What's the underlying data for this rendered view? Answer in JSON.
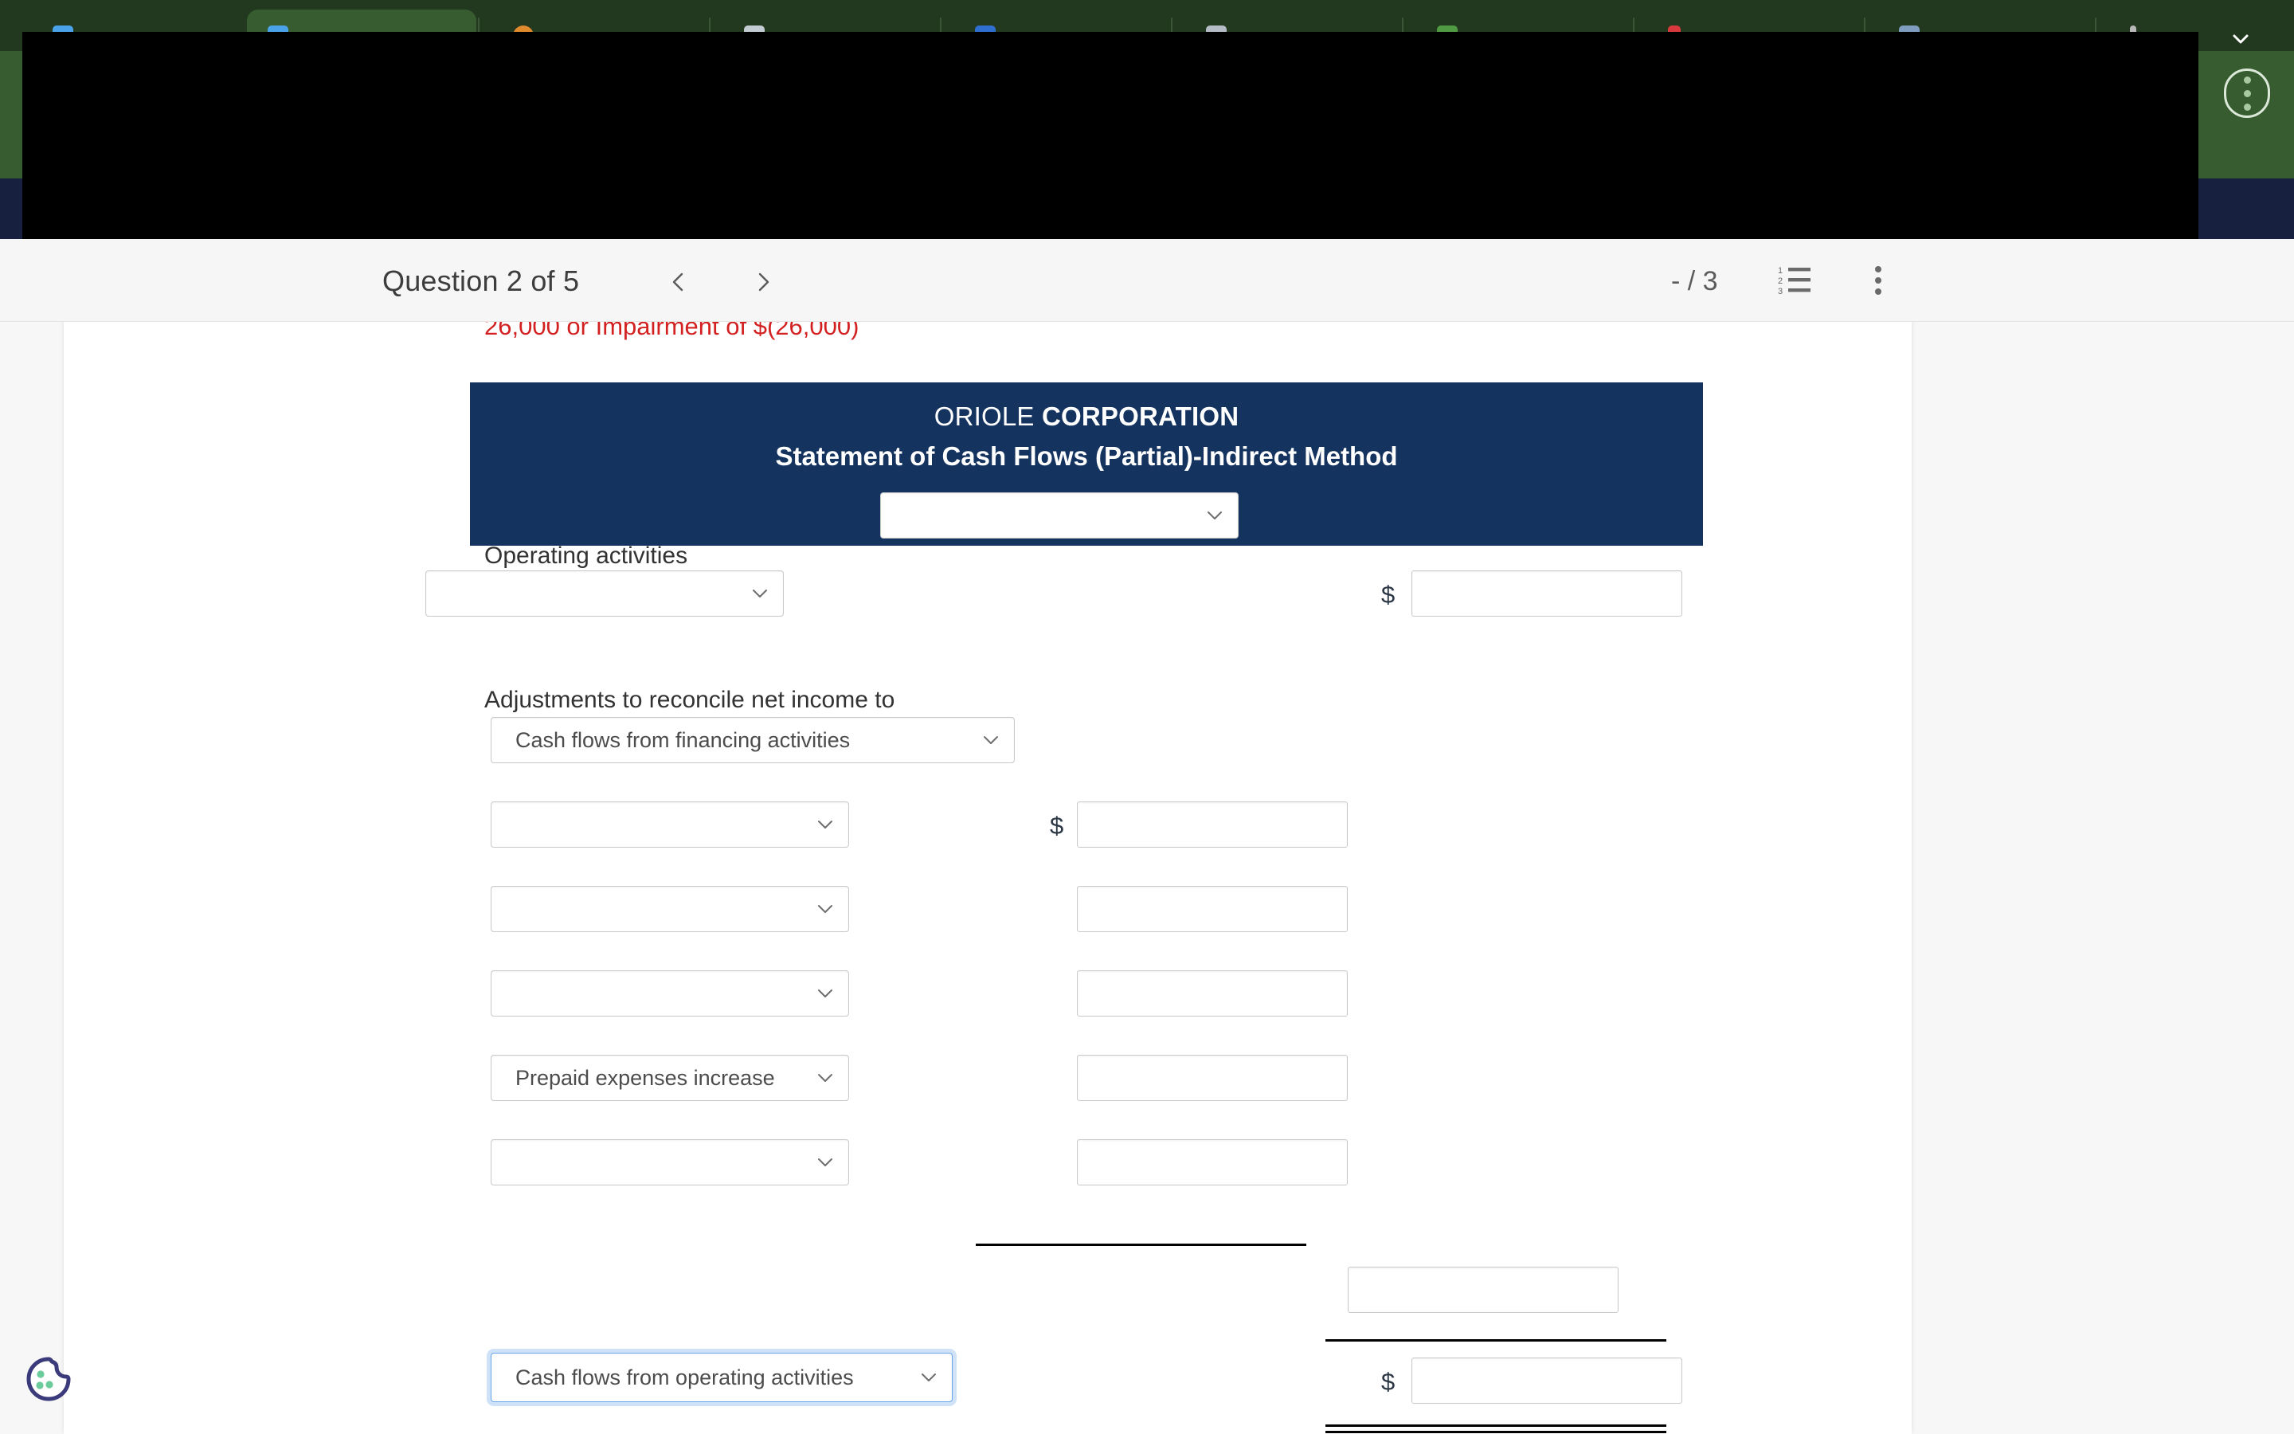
{
  "browser": {
    "tabs": [
      {
        "title": "",
        "favicon_color": "#4aa3e8",
        "active": false
      },
      {
        "title": "",
        "favicon_color": "#4aa3e8",
        "active": true
      },
      {
        "title": "",
        "favicon_color": "#e08a2e",
        "active": false
      },
      {
        "title": "",
        "favicon_color": "#c3ccd2",
        "active": false
      },
      {
        "title": "",
        "favicon_color": "#2f6fd0",
        "active": false
      },
      {
        "title": "",
        "favicon_color": "#b5bcc6",
        "active": false
      },
      {
        "title": "",
        "favicon_color": "#4f9a43",
        "active": false
      },
      {
        "title": "",
        "favicon_color": "#d8393c",
        "active": false
      },
      {
        "title": "",
        "favicon_color": "#7f9dbf",
        "active": false
      },
      {
        "title": "",
        "favicon_color": "#b9b9b9",
        "active": false
      }
    ],
    "tablist_chevron_icon": "chevron-down-icon",
    "toolbar_menu_icon": "kebab-menu-icon",
    "tabstrip_color": "#22381f",
    "toolbar_color": "#365c30",
    "bookmarkbar_color": "#17213f"
  },
  "header": {
    "question_label": "Question 2 of 5",
    "prev_icon": "chevron-left-icon",
    "next_icon": "chevron-right-icon",
    "score": "- / 3",
    "list_icon": "numbered-list-icon",
    "overflow_icon": "kebab-menu-icon"
  },
  "statement": {
    "clipped_feedback_text": "26,000 or Impairment of $(26,000)",
    "company_name_light": "ORIOLE ",
    "company_name_bold": "CORPORATION",
    "subtitle": "Statement of Cash Flows (Partial)-Indirect Method",
    "period_select_value": "",
    "banner_color": "#15335f"
  },
  "form": {
    "section_operating_label": "Operating activities",
    "net_income_select_value": "",
    "net_income_dollar": "$",
    "net_income_amount": "",
    "adjustments_label": "Adjustments to reconcile net income to",
    "adjustments_basis_select_value": "Cash flows from financing activities",
    "rows": [
      {
        "select_value": "",
        "dollar": "$",
        "amount": ""
      },
      {
        "select_value": "",
        "dollar": "",
        "amount": ""
      },
      {
        "select_value": "",
        "dollar": "",
        "amount": ""
      },
      {
        "select_value": "Prepaid expenses increase",
        "dollar": "",
        "amount": ""
      },
      {
        "select_value": "",
        "dollar": "",
        "amount": ""
      }
    ],
    "subtotal_amount": "",
    "total_select_value": "Cash flows from operating activities",
    "total_dollar": "$",
    "total_amount": "",
    "focus_ring_color": "#6aa6e8"
  },
  "cookie_widget": {
    "icon": "cookie-icon",
    "outline_color": "#3b3a7a",
    "chip_color": "#6ccb9a"
  }
}
